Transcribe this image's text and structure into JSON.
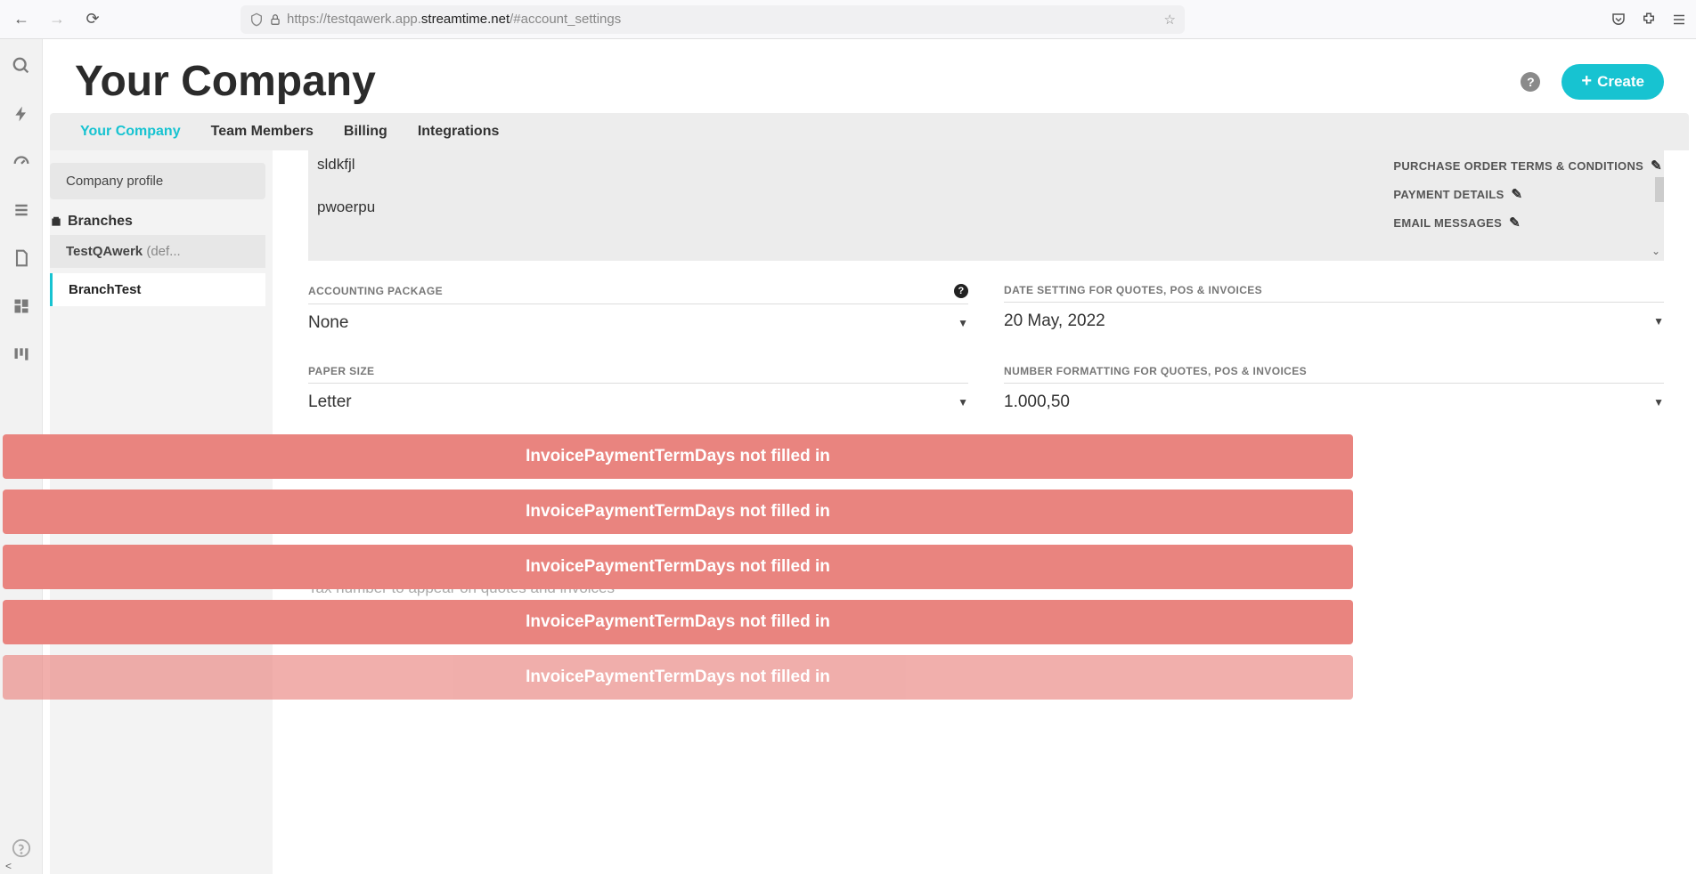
{
  "browser": {
    "url_prefix": "https://testqawerk.app.",
    "url_domain": "streamtime.net",
    "url_suffix": "/#account_settings"
  },
  "header": {
    "title": "Your Company",
    "create_label": "Create"
  },
  "tabs": [
    {
      "label": "Your Company",
      "active": true
    },
    {
      "label": "Team Members",
      "active": false
    },
    {
      "label": "Billing",
      "active": false
    },
    {
      "label": "Integrations",
      "active": false
    }
  ],
  "sidebar": {
    "profile_label": "Company profile",
    "branches_label": "Branches",
    "branches": [
      {
        "name": "TestQAwerk",
        "suffix": " (def...",
        "active": false
      },
      {
        "name": "BranchTest",
        "suffix": "",
        "active": true
      }
    ]
  },
  "textbox": {
    "line1": "sldkfjl",
    "line2": "pwoerpu"
  },
  "right_links": {
    "po_terms": "PURCHASE ORDER TERMS & CONDITIONS",
    "payment_details": "PAYMENT DETAILS",
    "email_messages": "EMAIL MESSAGES"
  },
  "fields": {
    "accounting_label": "ACCOUNTING PACKAGE",
    "accounting_value": "None",
    "date_setting_label": "DATE SETTING FOR QUOTES, POS & INVOICES",
    "date_setting_value": "20 May, 2022",
    "paper_label": "PAPER SIZE",
    "paper_value": "Letter",
    "number_fmt_label": "NUMBER FORMATTING FOR QUOTES, POS & INVOICES",
    "number_fmt_value": "1.000,50",
    "tax_note": "Tax number to appear on quotes and invoices"
  },
  "errors": [
    "InvoicePaymentTermDays not filled in",
    "InvoicePaymentTermDays not filled in",
    "InvoicePaymentTermDays not filled in",
    "InvoicePaymentTermDays not filled in",
    "InvoicePaymentTermDays not filled in"
  ]
}
